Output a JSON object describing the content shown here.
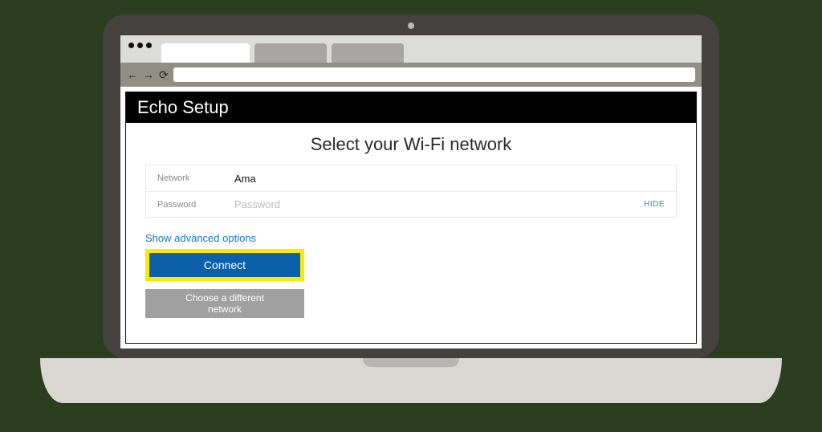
{
  "browser": {
    "back_label": "←",
    "forward_label": "→",
    "refresh_label": "⟳"
  },
  "header": {
    "title": "Echo Setup"
  },
  "page": {
    "heading": "Select your Wi-Fi network",
    "network_label": "Network",
    "network_value": "Ama",
    "password_label": "Password",
    "password_placeholder": "Password",
    "hide_label": "HIDE",
    "advanced_label": "Show advanced options",
    "connect_label": "Connect",
    "alt_label": "Choose a different network"
  }
}
